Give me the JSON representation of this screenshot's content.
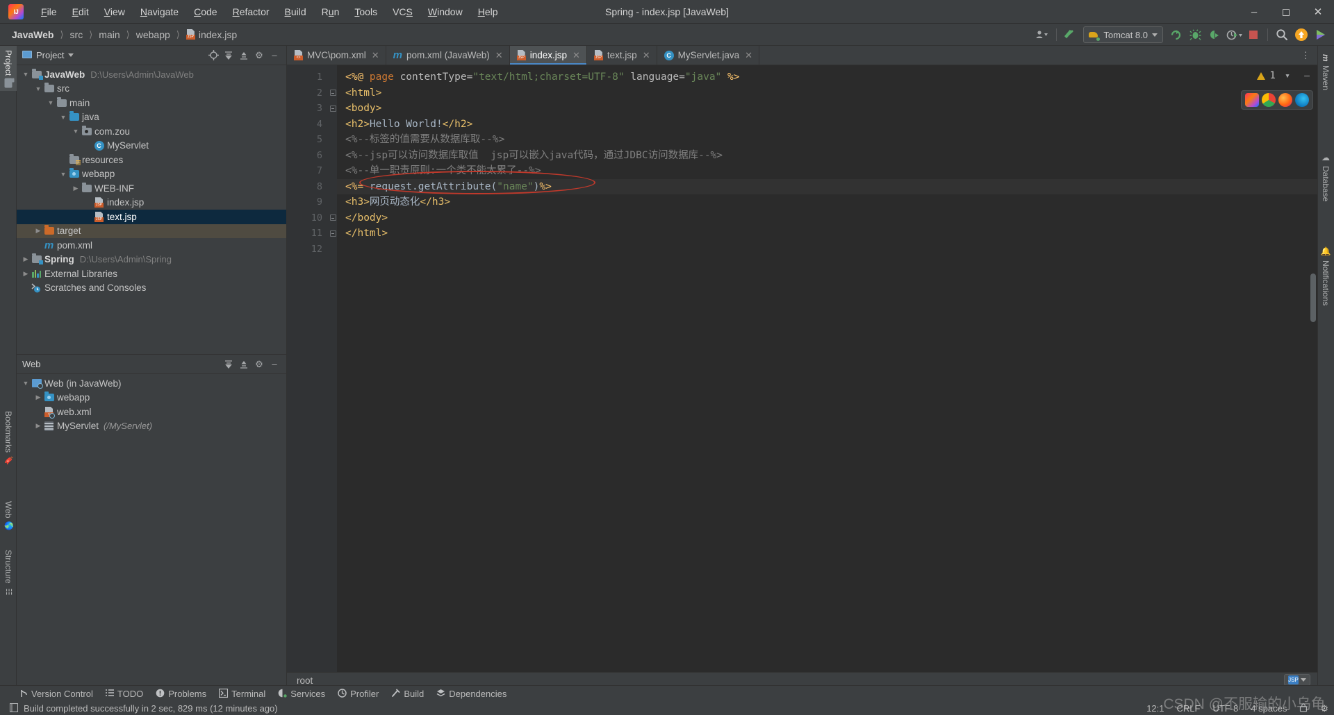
{
  "window": {
    "title": "Spring - index.jsp [JavaWeb]",
    "logo_icon": "intellij-idea-logo",
    "minimize_icon": "minimize-icon",
    "maximize_icon": "maximize-icon",
    "close_icon": "close-icon"
  },
  "menu": [
    {
      "label": "File"
    },
    {
      "label": "Edit"
    },
    {
      "label": "View"
    },
    {
      "label": "Navigate"
    },
    {
      "label": "Code"
    },
    {
      "label": "Refactor"
    },
    {
      "label": "Build"
    },
    {
      "label": "Run"
    },
    {
      "label": "Tools"
    },
    {
      "label": "VCS"
    },
    {
      "label": "Window"
    },
    {
      "label": "Help"
    }
  ],
  "breadcrumb": [
    {
      "label": "JavaWeb",
      "bold": true
    },
    {
      "label": "src",
      "bold": false
    },
    {
      "label": "main",
      "bold": false
    },
    {
      "label": "webapp",
      "bold": false
    },
    {
      "label": "index.jsp",
      "bold": false,
      "icon": "jsp-file-icon"
    }
  ],
  "toolbar": {
    "user_icon": "user-dropdown-icon",
    "updates_icon": "check-updates-icon",
    "run_config": "Tomcat 8.0",
    "run_icon": "run-icon",
    "debug_icon": "debug-icon",
    "run_with_coverage_icon": "run-coverage-icon",
    "profile_icon": "profiler-icon",
    "stop_icon": "stop-icon",
    "search_icon": "search-everywhere-icon",
    "update_project_icon": "update-project-icon",
    "ide_helper_icon": "ide-assistant-icon"
  },
  "left_tool_strip": [
    {
      "label": "Project",
      "icon": "project-icon",
      "active": true
    },
    {
      "label": "Bookmarks",
      "icon": "bookmark-icon",
      "active": false
    },
    {
      "label": "Web",
      "icon": "web-icon",
      "active": false
    },
    {
      "label": "Structure",
      "icon": "structure-icon",
      "active": false
    }
  ],
  "right_tool_strip": [
    {
      "label": "Maven",
      "icon": "maven-icon"
    },
    {
      "label": "Database",
      "icon": "database-icon"
    },
    {
      "label": "Notifications",
      "icon": "notifications-bell-icon"
    }
  ],
  "project_panel": {
    "title": "Project",
    "dropdown_icon": "chevron-down-icon",
    "actions": [
      "locate-icon",
      "expand-all-icon",
      "collapse-all-icon",
      "settings-gear-icon",
      "hide-icon"
    ],
    "tree": [
      {
        "label": "JavaWeb",
        "path": "D:\\Users\\Admin\\JavaWeb",
        "indent": 0,
        "arrow": "down",
        "icon": "module-folder-icon",
        "bold": true
      },
      {
        "label": "src",
        "indent": 1,
        "arrow": "down",
        "icon": "folder-icon"
      },
      {
        "label": "main",
        "indent": 2,
        "arrow": "down",
        "icon": "folder-icon"
      },
      {
        "label": "java",
        "indent": 3,
        "arrow": "down",
        "icon": "source-root-folder-icon"
      },
      {
        "label": "com.zou",
        "indent": 4,
        "arrow": "down",
        "icon": "package-icon"
      },
      {
        "label": "MyServlet",
        "indent": 5,
        "arrow": "none",
        "icon": "java-class-icon"
      },
      {
        "label": "resources",
        "indent": 3,
        "arrow": "none",
        "icon": "resources-folder-icon"
      },
      {
        "label": "webapp",
        "indent": 3,
        "arrow": "down",
        "icon": "web-root-folder-icon"
      },
      {
        "label": "WEB-INF",
        "indent": 4,
        "arrow": "right",
        "icon": "folder-icon"
      },
      {
        "label": "index.jsp",
        "indent": 4,
        "arrow": "none",
        "icon": "jsp-file-icon"
      },
      {
        "label": "text.jsp",
        "indent": 4,
        "arrow": "none",
        "icon": "jsp-file-icon",
        "selected": true
      },
      {
        "label": "target",
        "indent": 1,
        "arrow": "right",
        "icon": "excluded-folder-icon",
        "marked": true
      },
      {
        "label": "pom.xml",
        "indent": 1,
        "arrow": "none",
        "icon": "maven-pom-icon"
      },
      {
        "label": "Spring",
        "path": "D:\\Users\\Admin\\Spring",
        "indent": 0,
        "arrow": "right",
        "icon": "module-folder-icon",
        "bold": true
      },
      {
        "label": "External Libraries",
        "indent": 0,
        "arrow": "right",
        "icon": "external-libraries-icon"
      },
      {
        "label": "Scratches and Consoles",
        "indent": 0,
        "arrow": "none",
        "icon": "scratches-icon"
      }
    ]
  },
  "web_panel": {
    "title": "Web",
    "actions": [
      "expand-all-icon",
      "collapse-all-icon",
      "settings-gear-icon",
      "hide-icon"
    ],
    "tree": [
      {
        "label": "Web (in JavaWeb)",
        "indent": 0,
        "arrow": "down",
        "icon": "web-facet-icon"
      },
      {
        "label": "webapp",
        "indent": 1,
        "arrow": "right",
        "icon": "web-root-folder-icon"
      },
      {
        "label": "web.xml",
        "indent": 1,
        "arrow": "none",
        "icon": "web-xml-icon"
      },
      {
        "label": "MyServlet",
        "mapping": "(/MyServlet)",
        "indent": 1,
        "arrow": "right",
        "icon": "servlet-icon"
      }
    ]
  },
  "editor": {
    "tabs": [
      {
        "label": "MVC\\pom.xml",
        "icon": "xml-file-icon",
        "active": false
      },
      {
        "label": "pom.xml (JavaWeb)",
        "icon": "maven-pom-icon",
        "active": false
      },
      {
        "label": "index.jsp",
        "icon": "jsp-file-icon",
        "active": true
      },
      {
        "label": "text.jsp",
        "icon": "jsp-file-icon",
        "active": false
      },
      {
        "label": "MyServlet.java",
        "icon": "java-class-icon",
        "active": false
      }
    ],
    "more_tabs_icon": "more-vertical-icon",
    "warning_count": "1",
    "warning_icon": "warning-triangle-icon",
    "inspections_icon": "chevron-down-icon",
    "hide_icon": "minimize-icon",
    "browsers": [
      "ij-browser-icon",
      "chrome-icon",
      "firefox-icon",
      "edge-icon"
    ],
    "line_numbers": [
      "1",
      "2",
      "3",
      "4",
      "5",
      "6",
      "7",
      "8",
      "9",
      "10",
      "11",
      "12"
    ],
    "lines": [
      {
        "n": 1,
        "fold": false,
        "tokens": [
          {
            "t": "<%@ ",
            "c": "tk-jsp"
          },
          {
            "t": "page",
            "c": "tk-kw"
          },
          {
            "t": " contentType=",
            "c": "tk-attr"
          },
          {
            "t": "\"text/html;charset=UTF-8\"",
            "c": "tk-str"
          },
          {
            "t": " language=",
            "c": "tk-attr"
          },
          {
            "t": "\"java\"",
            "c": "tk-str"
          },
          {
            "t": " %>",
            "c": "tk-jsp"
          }
        ]
      },
      {
        "n": 2,
        "fold": true,
        "tokens": [
          {
            "t": "<html>",
            "c": "tk-tag"
          }
        ]
      },
      {
        "n": 3,
        "fold": true,
        "tokens": [
          {
            "t": "<body>",
            "c": "tk-tag"
          }
        ]
      },
      {
        "n": 4,
        "fold": false,
        "tokens": [
          {
            "t": "<h2>",
            "c": "tk-tag"
          },
          {
            "t": "Hello World!",
            "c": "tk-txt"
          },
          {
            "t": "</h2>",
            "c": "tk-tag"
          }
        ]
      },
      {
        "n": 5,
        "fold": false,
        "tokens": [
          {
            "t": "<%--标签的值需要从数据库取--%>",
            "c": "tk-cmt"
          }
        ]
      },
      {
        "n": 6,
        "fold": false,
        "tokens": [
          {
            "t": "<%--jsp可以访问数据库取值  jsp可以嵌入java代码，通过JDBC访问数据库--%>",
            "c": "tk-cmt"
          }
        ]
      },
      {
        "n": 7,
        "fold": false,
        "tokens": [
          {
            "t": "<%--单一职责原则:一个类不能太累了--%>",
            "c": "tk-cmt"
          }
        ]
      },
      {
        "n": 8,
        "fold": false,
        "current": true,
        "tokens": [
          {
            "t": "<%= ",
            "c": "tk-jsp"
          },
          {
            "t": "request",
            "c": "tk-txt"
          },
          {
            "t": ".",
            "c": "tk-punc"
          },
          {
            "t": "getAttribute",
            "c": "tk-txt"
          },
          {
            "t": "(",
            "c": "tk-punc"
          },
          {
            "t": "\"name\"",
            "c": "tk-str"
          },
          {
            "t": ")",
            "c": "tk-punc"
          },
          {
            "t": "%>",
            "c": "tk-jsp"
          }
        ]
      },
      {
        "n": 9,
        "fold": false,
        "tokens": [
          {
            "t": "<h3>",
            "c": "tk-tag"
          },
          {
            "t": "网页动态化",
            "c": "tk-txt"
          },
          {
            "t": "</h3>",
            "c": "tk-tag"
          }
        ]
      },
      {
        "n": 10,
        "fold": true,
        "tokens": [
          {
            "t": "</body>",
            "c": "tk-tag"
          }
        ]
      },
      {
        "n": 11,
        "fold": true,
        "tokens": [
          {
            "t": "</html>",
            "c": "tk-tag"
          }
        ]
      },
      {
        "n": 12,
        "fold": false,
        "tokens": []
      }
    ],
    "annotation": {
      "shape": "red-ellipse",
      "color": "#c0392b",
      "around_line": 8
    },
    "bottom_breadcrumb": "root",
    "lang_chip": "jsp-language-level-icon"
  },
  "tool_windows": [
    {
      "label": "Version Control",
      "icon": "branch-icon"
    },
    {
      "label": "TODO",
      "icon": "todo-list-icon"
    },
    {
      "label": "Problems",
      "icon": "problems-icon"
    },
    {
      "label": "Terminal",
      "icon": "terminal-icon"
    },
    {
      "label": "Services",
      "icon": "services-icon"
    },
    {
      "label": "Profiler",
      "icon": "profiler-icon"
    },
    {
      "label": "Build",
      "icon": "build-hammer-icon"
    },
    {
      "label": "Dependencies",
      "icon": "dependencies-icon"
    }
  ],
  "status_bar": {
    "message_icon": "event-log-icon",
    "message": "Build completed successfully in 2 sec, 829 ms (12 minutes ago)",
    "caret_position": "12:1",
    "line_separator": "CRLF",
    "encoding": "UTF-8",
    "indent": "4 spaces",
    "lock_icon": "read-only-lock-icon",
    "gear_icon": "settings-gear-icon"
  },
  "watermark": "CSDN @不服输的小乌龟",
  "colors": {
    "accent": "#4a88c7",
    "selection": "#0d293e",
    "annotation": "#c0392b",
    "editor_bg": "#2b2b2b",
    "panel_bg": "#3c3f41"
  }
}
